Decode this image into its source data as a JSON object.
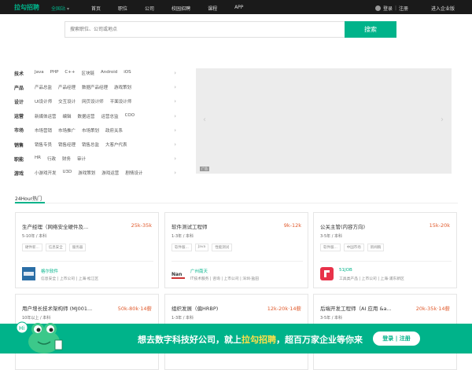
{
  "topbar": {
    "logo": "拉勾招聘",
    "city": "全国站",
    "nav": [
      "首页",
      "职位",
      "公司",
      "校园招聘",
      "课程",
      "APP"
    ],
    "login": "登录",
    "register": "注册",
    "enterprise": "进入企业版"
  },
  "search": {
    "placeholder": "搜索职位、公司或地点",
    "button": "搜索"
  },
  "categories": [
    {
      "name": "技术",
      "items": [
        "Java",
        "PHP",
        "C++",
        "区块链",
        "Android",
        "iOS"
      ]
    },
    {
      "name": "产品",
      "items": [
        "产品总监",
        "产品经理",
        "数据产品经理",
        "游戏策划"
      ]
    },
    {
      "name": "设计",
      "items": [
        "UI设计师",
        "交互设计",
        "网页设计师",
        "平面设计师"
      ]
    },
    {
      "name": "运营",
      "items": [
        "新媒体运营",
        "编辑",
        "数据运营",
        "运营总监",
        "COO"
      ]
    },
    {
      "name": "市场",
      "items": [
        "市场营销",
        "市场推广",
        "市场策划",
        "政府关系"
      ]
    },
    {
      "name": "销售",
      "items": [
        "销售专员",
        "销售经理",
        "销售总监",
        "大客户代表"
      ]
    },
    {
      "name": "职能",
      "items": [
        "HR",
        "行政",
        "财务",
        "审计"
      ]
    },
    {
      "name": "游戏",
      "items": [
        "小游戏开发",
        "U3D",
        "游戏策划",
        "游戏运营",
        "剧情设计"
      ]
    }
  ],
  "banner": {
    "ad_label": "广告"
  },
  "hot": {
    "tab": "24Hour热门"
  },
  "jobs": [
    {
      "title": "生产经理（网络安全硬件及...",
      "salary": "25k-35k",
      "req": "5-10年 / 本科",
      "tags": [
        "硬件新...",
        "信息安全",
        "服务器"
      ],
      "company": "格尔软件",
      "info": "信息安全 | 上市公司 | 上海·松江区",
      "logo_color": "#2a6ea6"
    },
    {
      "title": "软件测试工程师",
      "salary": "9k-12k",
      "req": "1-3年 / 本科",
      "tags": [
        "软件服...",
        "Java",
        "性能测试"
      ],
      "company": "广州南天",
      "info": "IT技术服务 | 咨询 | 上市公司 | 深圳·盐田",
      "logo_color": "#333333"
    },
    {
      "title": "公关主管(内容方向)",
      "salary": "15k-20k",
      "req": "3-5年 / 本科",
      "tags": [
        "软件服...",
        "中国市场",
        "新闻稿"
      ],
      "company": "51JOB",
      "info": "工具类产品 | 上市公司 | 上海·浦东新区",
      "logo_color": "#e8324a"
    },
    {
      "title": "用户增长技术架构师 (MJ001...",
      "salary": "50k-80k·14薪",
      "req": "10年以上 / 本科",
      "tags": [],
      "company": "",
      "info": "",
      "logo_color": ""
    },
    {
      "title": "组织发展（偏HRBP)",
      "salary": "12k-20k·14薪",
      "req": "1-3年 / 本科",
      "tags": [],
      "company": "",
      "info": "",
      "logo_color": ""
    },
    {
      "title": "后端开发工程师（AI 应用 &a...",
      "salary": "20k-35k·14薪",
      "req": "3-5年 / 本科",
      "tags": [],
      "company": "",
      "info": "",
      "logo_color": ""
    }
  ],
  "footer": {
    "slogan_a": "想去数字科技好公司，就上",
    "slogan_b": "拉勾招聘",
    "slogan_c": "，超百万家企业等你来",
    "cta": "登录 | 注册"
  },
  "colors": {
    "brand": "#00b38a",
    "salary": "#e05a2c"
  }
}
